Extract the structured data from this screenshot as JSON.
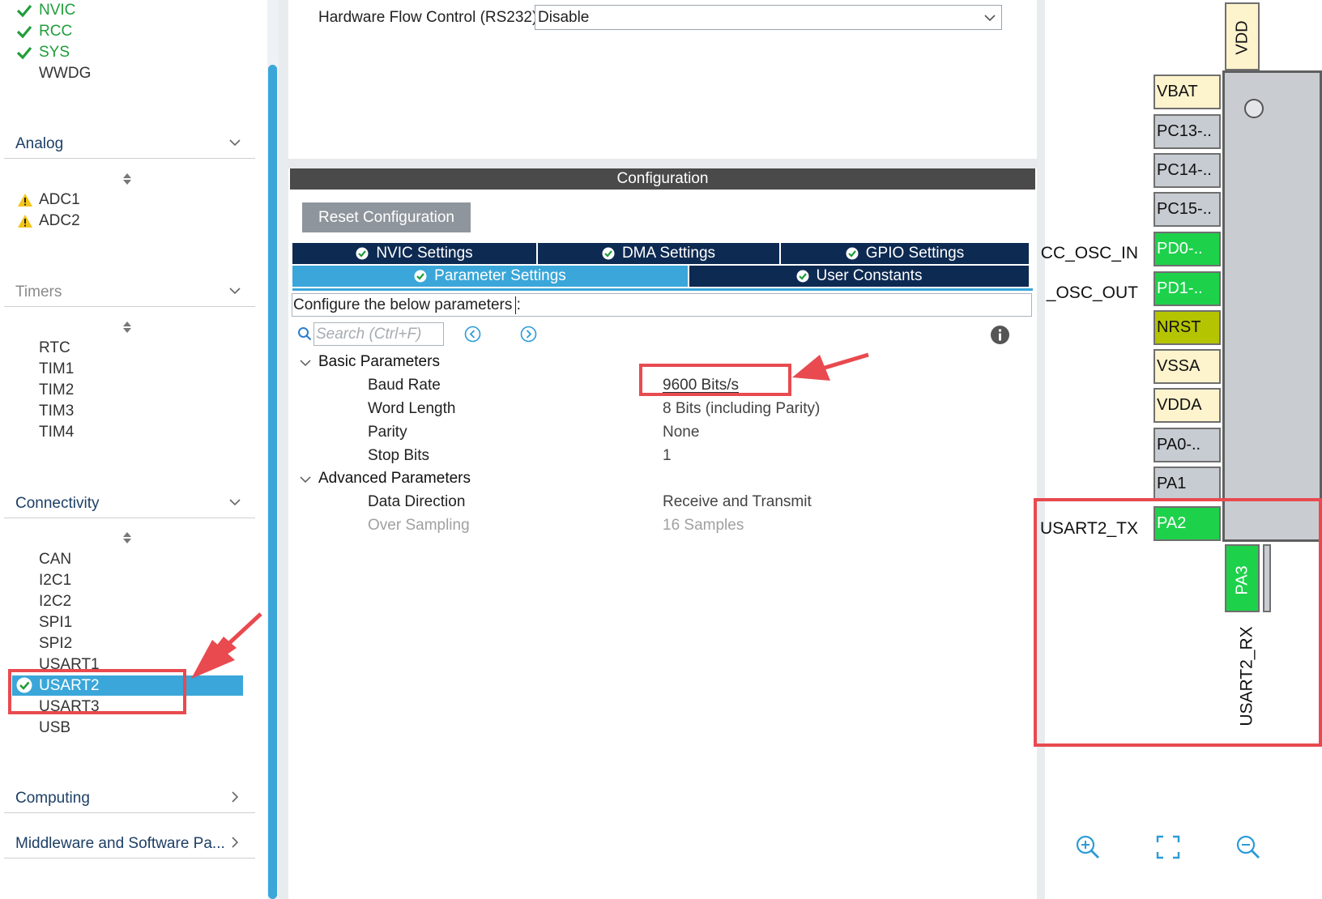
{
  "sidebar": {
    "system_items": [
      {
        "label": "NVIC",
        "status": "ok"
      },
      {
        "label": "RCC",
        "status": "ok"
      },
      {
        "label": "SYS",
        "status": "ok"
      },
      {
        "label": "WWDG",
        "status": "none"
      }
    ],
    "analog": {
      "title": "Analog",
      "items": [
        {
          "label": "ADC1",
          "status": "warning"
        },
        {
          "label": "ADC2",
          "status": "warning"
        }
      ]
    },
    "timers": {
      "title": "Timers",
      "items": [
        "RTC",
        "TIM1",
        "TIM2",
        "TIM3",
        "TIM4"
      ]
    },
    "connectivity": {
      "title": "Connectivity",
      "items": [
        "CAN",
        "I2C1",
        "I2C2",
        "SPI1",
        "SPI2",
        "USART1",
        "USART2",
        "USART3",
        "USB"
      ],
      "selected": "USART2"
    },
    "computing": {
      "title": "Computing"
    },
    "middleware": {
      "title": "Middleware and Software Pa..."
    }
  },
  "top_setting": {
    "label": "Hardware Flow Control (RS232)",
    "value": "Disable"
  },
  "configuration": {
    "header": "Configuration",
    "reset_button": "Reset Configuration",
    "tabs_row1": [
      "NVIC Settings",
      "DMA Settings",
      "GPIO Settings"
    ],
    "tabs_row2": [
      "Parameter Settings",
      "User Constants"
    ],
    "active_tab": "Parameter Settings",
    "configure_text": "Configure the below parameters :",
    "search_placeholder": "Search (Ctrl+F)",
    "basic": {
      "title": "Basic Parameters",
      "params": [
        {
          "name": "Baud Rate",
          "value": "9600 Bits/s"
        },
        {
          "name": "Word Length",
          "value": "8 Bits (including Parity)"
        },
        {
          "name": "Parity",
          "value": "None"
        },
        {
          "name": "Stop Bits",
          "value": "1"
        }
      ]
    },
    "advanced": {
      "title": "Advanced Parameters",
      "params": [
        {
          "name": "Data Direction",
          "value": "Receive and Transmit"
        },
        {
          "name": "Over Sampling",
          "value": "16 Samples",
          "disabled": true
        }
      ]
    }
  },
  "chip": {
    "top_pin": "VDD",
    "left_pins": [
      {
        "label": "VBAT",
        "style": "cream",
        "signal": ""
      },
      {
        "label": "PC13-..",
        "style": "gray",
        "signal": ""
      },
      {
        "label": "PC14-..",
        "style": "gray",
        "signal": ""
      },
      {
        "label": "PC15-..",
        "style": "gray",
        "signal": ""
      },
      {
        "label": "PD0-..",
        "style": "green",
        "signal": "CC_OSC_IN"
      },
      {
        "label": "PD1-..",
        "style": "green",
        "signal": "_OSC_OUT"
      },
      {
        "label": "NRST",
        "style": "olive",
        "signal": ""
      },
      {
        "label": "VSSA",
        "style": "cream",
        "signal": ""
      },
      {
        "label": "VDDA",
        "style": "cream",
        "signal": ""
      },
      {
        "label": "PA0-..",
        "style": "gray",
        "signal": ""
      },
      {
        "label": "PA1",
        "style": "gray",
        "signal": ""
      },
      {
        "label": "PA2",
        "style": "green",
        "signal": "USART2_TX"
      }
    ],
    "bottom_pin": {
      "label": "PA3",
      "signal": "USART2_RX"
    }
  },
  "colors": {
    "accent": "#3aa6d9",
    "tab_dark": "#0d2a52",
    "pin_green": "#1ed14b",
    "annotation_red": "#e84a4f"
  },
  "icons": [
    "check-icon",
    "warning-icon",
    "chevron-down-icon",
    "chevron-right-icon",
    "sort-icon",
    "search-icon",
    "prev-icon",
    "next-icon",
    "info-icon",
    "zoom-in-icon",
    "fit-icon",
    "zoom-out-icon"
  ]
}
